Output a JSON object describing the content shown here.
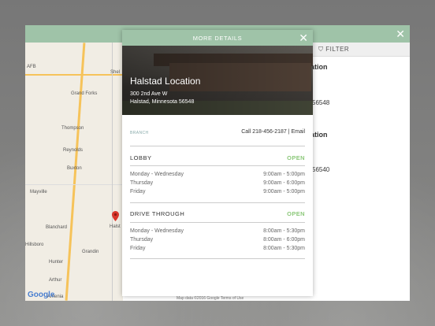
{
  "app": {
    "filter_label": "FILTER",
    "close_icon": "close-icon",
    "list": [
      {
        "name_fragment": "ation",
        "zip_fragment": "56548"
      },
      {
        "name_fragment": "ation",
        "zip_fragment": "56540"
      }
    ],
    "map_attribution": "Map data ©2016 Google   Terms of Use",
    "map_labels": [
      "Grand Forks",
      "Thompson",
      "Reynolds",
      "Buxton",
      "Mayville",
      "Blanchard",
      "Hillsboro",
      "Grandin",
      "Hunter",
      "Arthur",
      "Amenia",
      "Halst",
      "Shel",
      "AFB"
    ],
    "map_brand": "Google"
  },
  "modal": {
    "title": "MORE DETAILS",
    "location_name": "Halstad Location",
    "address_line1": "300 2nd Ave W",
    "address_line2": "Halstad, Minnesota 56548",
    "branch_label": "BRANCH",
    "call_text": "Call 218-456-2187 | Email",
    "lobby": {
      "title": "LOBBY",
      "status": "OPEN",
      "hours": [
        {
          "days": "Monday - Wednesday",
          "time": "9:00am - 5:00pm"
        },
        {
          "days": "Thursday",
          "time": "9:00am - 6:00pm"
        },
        {
          "days": "Friday",
          "time": "9:00am - 5:00pm"
        }
      ]
    },
    "drive": {
      "title": "DRIVE THROUGH",
      "status": "OPEN",
      "hours": [
        {
          "days": "Monday - Wednesday",
          "time": "8:00am - 5:30pm"
        },
        {
          "days": "Thursday",
          "time": "8:00am - 6:00pm"
        },
        {
          "days": "Friday",
          "time": "8:00am - 5:30pm"
        }
      ]
    }
  },
  "colors": {
    "accent": "#9fc3a8",
    "open": "#8cc87a"
  }
}
